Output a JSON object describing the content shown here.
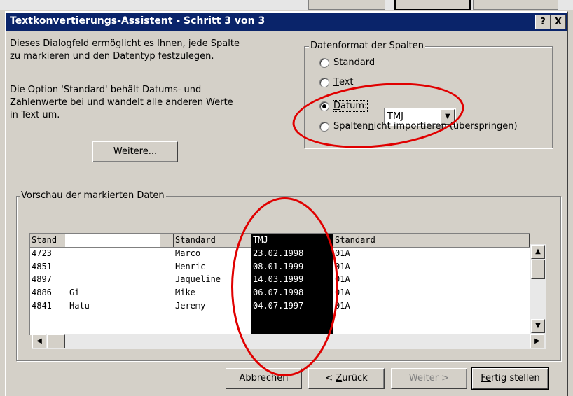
{
  "dialog": {
    "title": "Textkonvertierungs-Assistent - Schritt 3 von 3",
    "help_label": "?",
    "close_label": "X"
  },
  "description": {
    "line1": "Dieses Dialogfeld ermöglicht es Ihnen, jede Spalte",
    "line2": "zu markieren und den Datentyp festzulegen.",
    "line3": "Die Option 'Standard' behält Datums- und",
    "line4": "Zahlenwerte bei und wandelt alle anderen Werte",
    "line5": "in Text um."
  },
  "buttons": {
    "weitere_prefix": "W",
    "weitere_rest": "eitere...",
    "abbrechen": "Abbrechen",
    "zurueck_prefix": "< ",
    "zurueck_u": "Z",
    "zurueck_rest": "urück",
    "weiter": "Weiter >",
    "fertig_prefix": "F",
    "fertig_u": "e",
    "fertig_rest": "rtig stellen"
  },
  "format_group": {
    "legend": "Datenformat der Spalten",
    "standard_u": "S",
    "standard_rest": "tandard",
    "text_u": "T",
    "text_rest": "ext",
    "datum_u": "D",
    "datum_rest": "atum:",
    "datum_value": "TMJ",
    "skip_a": "Spalten ",
    "skip_u": "n",
    "skip_b": "icht importieren (überspringen)",
    "selected": "datum"
  },
  "preview": {
    "legend": "Vorschau der markierten Daten",
    "headers": [
      "Stand",
      "Standard",
      "TMJ",
      "Standard"
    ],
    "col1": [
      "4723",
      "4851",
      "4897",
      "4886",
      "4841"
    ],
    "col1b": [
      "",
      "",
      "",
      "Gi",
      "Hatu"
    ],
    "col2": [
      "Marco",
      "Henric",
      "Jaqueline",
      "Mike",
      "Jeremy"
    ],
    "col3": [
      "23.02.1998",
      "08.01.1999",
      "14.03.1999",
      "06.07.1998",
      "04.07.1997"
    ],
    "col4": [
      "01A",
      "01A",
      "01A",
      "01A",
      "01A"
    ]
  },
  "colors": {
    "title_bar": "#0a246a",
    "annotation": "#e00000",
    "face": "#d4d0c8"
  }
}
